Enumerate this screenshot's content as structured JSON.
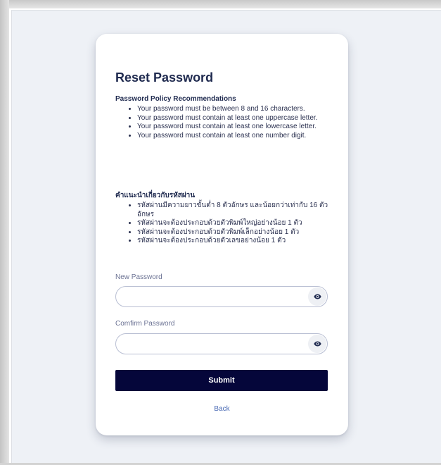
{
  "reset_form": {
    "title": "Reset Password",
    "policy_en": {
      "heading": "Password Policy Recommendations",
      "items": [
        "Your password must be between 8 and 16 characters.",
        "Your password must contain at least one uppercase letter.",
        "Your password must contain at least one lowercase letter.",
        "Your password must contain at least one number digit."
      ]
    },
    "policy_th": {
      "heading": "คำแนะนำเกี่ยวกับรหัสผ่าน",
      "items": [
        "รหัสผ่านมีความยาวขั้นต่ำ 8 ตัวอักษร และน้อยกว่าเท่ากับ 16 ตัวอักษร",
        "รหัสผ่านจะต้องประกอบด้วยตัวพิมพ์ใหญ่อย่างน้อย 1 ตัว",
        "รหัสผ่านจะต้องประกอบด้วยตัวพิมพ์เล็กอย่างน้อย 1 ตัว",
        "รหัสผ่านจะต้องประกอบด้วยตัวเลขอย่างน้อย 1 ตัว"
      ]
    },
    "new_password": {
      "label": "New Password",
      "value": "",
      "toggle_icon": "eye-icon"
    },
    "confirm_password": {
      "label": "Comfirm Password",
      "value": "",
      "toggle_icon": "eye-icon"
    },
    "submit_label": "Submit",
    "back_label": "Back"
  },
  "colors": {
    "page_background": "#eef1f6",
    "card_background": "#ffffff",
    "title_text": "#1f2a4f",
    "submit_button": "#05063a",
    "back_link": "#4b6bb5",
    "field_border": "#b9bfd3"
  }
}
